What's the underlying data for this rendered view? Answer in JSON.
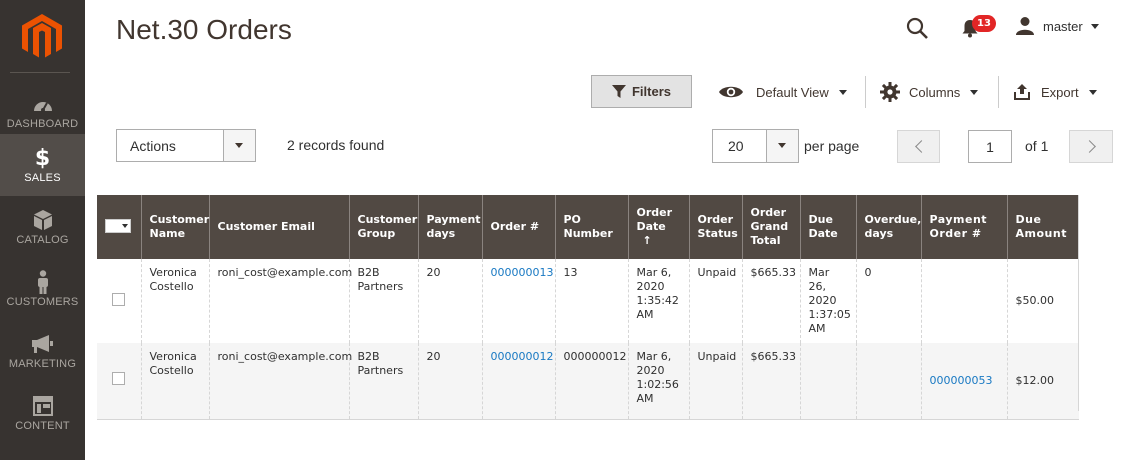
{
  "sidebar": {
    "items": [
      {
        "label": "DASHBOARD",
        "icon": "dashboard-icon",
        "active": false
      },
      {
        "label": "SALES",
        "icon": "dollar-icon",
        "active": true
      },
      {
        "label": "CATALOG",
        "icon": "cube-icon",
        "active": false
      },
      {
        "label": "CUSTOMERS",
        "icon": "person-icon",
        "active": false
      },
      {
        "label": "MARKETING",
        "icon": "megaphone-icon",
        "active": false
      },
      {
        "label": "CONTENT",
        "icon": "layout-icon",
        "active": false
      }
    ]
  },
  "header": {
    "title": "Net.30 Orders",
    "notifications_count": "13",
    "user_name": "master"
  },
  "toolbar": {
    "filters_label": "Filters",
    "view_label": "Default View",
    "columns_label": "Columns",
    "export_label": "Export"
  },
  "actions": {
    "label": "Actions",
    "records_found": "2 records found"
  },
  "pagination": {
    "per_page_value": "20",
    "per_page_label": "per page",
    "page_value": "1",
    "of_label": "of 1"
  },
  "grid": {
    "columns": [
      "Customer Name",
      "Customer Email",
      "Customer Group",
      "Payment days",
      "Order #",
      "PO Number",
      "Order Date",
      "Order Status",
      "Order Grand Total",
      "Due Date",
      "Overdue, days",
      "Payment Order #",
      "Due Amount"
    ],
    "sort_indicator": "↑",
    "rows": [
      {
        "customer_name": "Veronica Costello",
        "customer_email": "roni_cost@example.com",
        "customer_group": "B2B Partners",
        "payment_days": "20",
        "order_number": "000000013",
        "po_number": "13",
        "order_date": "Mar 6, 2020 1:35:42 AM",
        "order_status": "Unpaid",
        "grand_total": "$665.33",
        "due_date": "Mar 26, 2020 1:37:05 AM",
        "overdue_days": "0",
        "payment_order": "",
        "due_amount": "$50.00"
      },
      {
        "customer_name": "Veronica Costello",
        "customer_email": "roni_cost@example.com",
        "customer_group": "B2B Partners",
        "payment_days": "20",
        "order_number": "000000012",
        "po_number": "000000012",
        "order_date": "Mar 6, 2020 1:02:56 AM",
        "order_status": "Unpaid",
        "grand_total": "$665.33",
        "due_date": "",
        "overdue_days": "",
        "payment_order": "000000053",
        "due_amount": "$12.00"
      }
    ]
  },
  "colors": {
    "sidebar_bg": "#373330",
    "sidebar_active": "#524d49",
    "grid_header_bg": "#514943",
    "link": "#1979c3",
    "logo": "#eb5202",
    "badge": "#e22626"
  }
}
